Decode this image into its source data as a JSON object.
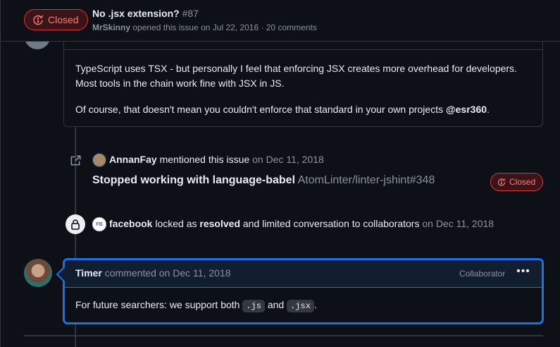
{
  "header": {
    "state": "Closed",
    "title": "No .jsx extension?",
    "number": "#87",
    "author": "MrSkinny",
    "meta": "opened this issue on Jul 22, 2016 · 20 comments"
  },
  "comment1": {
    "paragraph1": "TypeScript uses TSX - but personally I feel that enforcing JSX creates more overhead for developers. Most tools in the chain work fine with JSX in JS.",
    "paragraph2_prefix": "Of course, that doesn't mean you couldn't enforce that standard in your own projects ",
    "paragraph2_mention": "@esr360",
    "paragraph2_suffix": "."
  },
  "event_mention": {
    "actor": "AnnanFay",
    "action": "mentioned this issue",
    "date": "on Dec 11, 2018",
    "ref_title": "Stopped working with language-babel",
    "ref_repo": "AtomLinter/linter-jshint#348",
    "ref_state": "Closed"
  },
  "event_lock": {
    "actor": "facebook",
    "avatar_text": "FB",
    "text1": "locked as",
    "reason": "resolved",
    "text2": "and limited conversation to collaborators",
    "date": "on Dec 11, 2018"
  },
  "comment2": {
    "author": "Timer",
    "meta": "commented on Dec 11, 2018",
    "role": "Collaborator",
    "body_prefix": "For future searchers: we support both ",
    "code1": ".js",
    "body_mid": " and ",
    "code2": ".jsx",
    "body_suffix": "."
  },
  "colors": {
    "background": "#0d1117",
    "border": "#30363d",
    "closed": "#ff7b72",
    "focus": "#1f6feb",
    "muted": "#8b949e"
  }
}
